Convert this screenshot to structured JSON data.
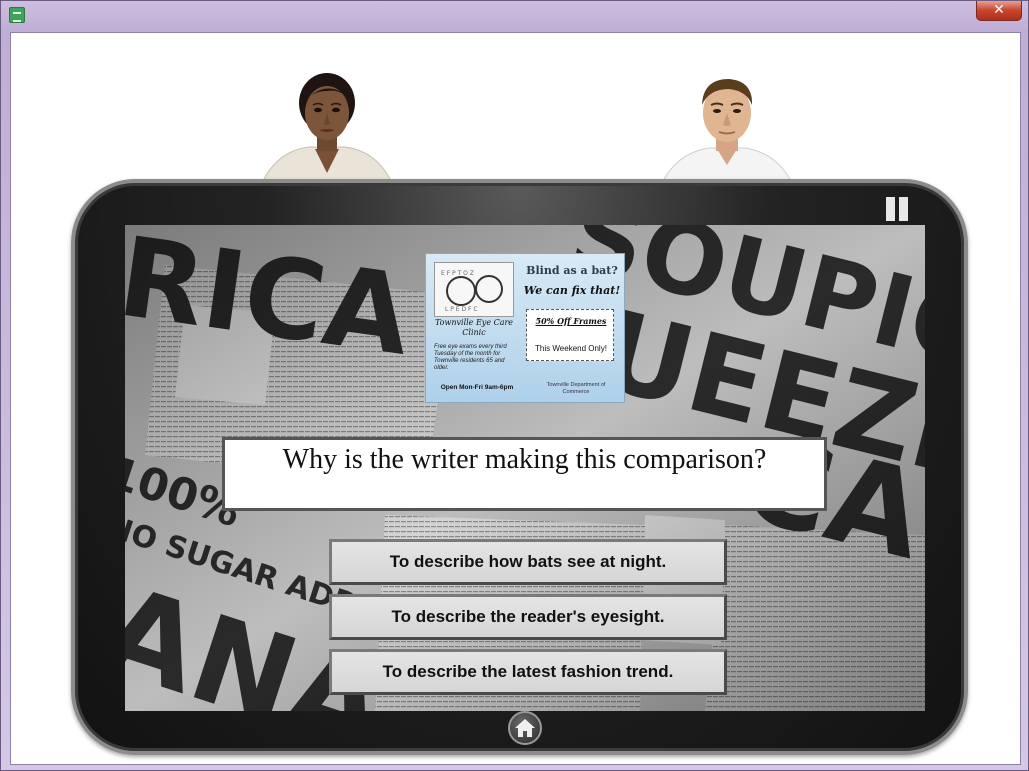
{
  "window": {
    "close_label": "✕"
  },
  "ad": {
    "clinic_name": "Townville Eye Care Clinic",
    "clinic_desc": "Free eye exams every third Tuesday of the month for Townville residents 65 and older.",
    "hours": "Open Mon-Fri 9am-6pm",
    "headline1": "Blind as a bat?",
    "headline2": "We can fix that!",
    "sale": "50% Off Frames",
    "weekend": "This Weekend Only!",
    "dept": "Townville Department of Commerce"
  },
  "question": {
    "text": "Why is the writer making this comparison?"
  },
  "answers": [
    {
      "label": "To describe how bats see at night."
    },
    {
      "label": "To describe the reader's eyesight."
    },
    {
      "label": "To describe the latest fashion trend."
    }
  ],
  "colors": {
    "tablet_body": "#1a1a1a",
    "answer_bg": "#dcdcdc",
    "question_bg": "#ffffff"
  }
}
